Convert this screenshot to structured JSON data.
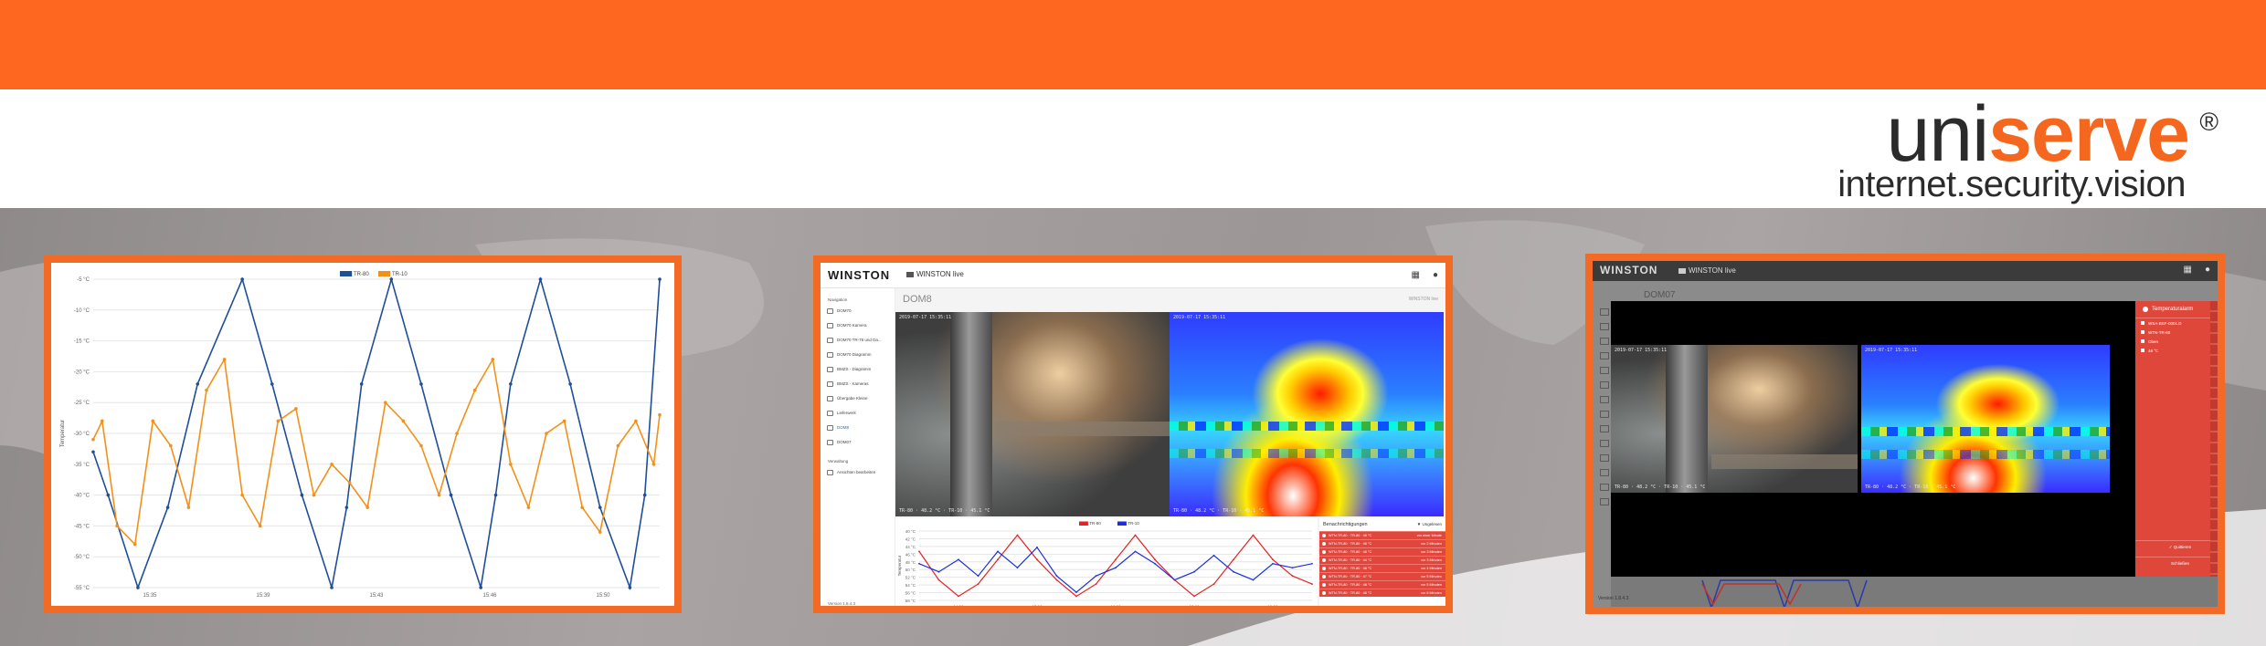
{
  "brand": {
    "logo_prefix": "uni",
    "logo_accent": "serve",
    "logo_registered": "®",
    "tagline": "internet.security.vision",
    "accent_color": "#fe671f"
  },
  "chart_data": [
    {
      "type": "line",
      "legend_position": "top-center",
      "grid": true,
      "ylabel": "Temperatur",
      "yticks": [
        "-5 °C",
        "-10 °C",
        "-15 °C",
        "-20 °C",
        "-25 °C",
        "-30 °C",
        "-35 °C",
        "-40 °C",
        "-45 °C",
        "-50 °C",
        "-55 °C"
      ],
      "ylim": [
        -55,
        -5
      ],
      "xticks": [
        "15:35",
        "15:39",
        "15:43",
        "15:46",
        "15:50"
      ],
      "series": [
        {
          "name": "TR-80",
          "color": "#1f4e9a",
          "x": [
            0,
            0.5,
            1.5,
            2.5,
            3.5,
            5,
            6,
            7,
            8,
            8.5,
            9,
            10,
            11,
            12,
            13,
            13.5,
            14,
            15,
            16,
            17,
            18,
            18.5,
            19
          ],
          "y": [
            -33,
            -40,
            -55,
            -42,
            -22,
            -5,
            -22,
            -40,
            -55,
            -42,
            -22,
            -5,
            -22,
            -40,
            -55,
            -40,
            -22,
            -5,
            -22,
            -42,
            -55,
            -40,
            -5
          ]
        },
        {
          "name": "TR-10",
          "color": "#f39019",
          "x": [
            0,
            0.3,
            0.8,
            1.4,
            2,
            2.6,
            3.2,
            3.8,
            4.4,
            5.0,
            5.6,
            6.2,
            6.8,
            7.4,
            8,
            8.6,
            9.2,
            9.8,
            10.4,
            11,
            11.6,
            12.2,
            12.8,
            13.4,
            14,
            14.6,
            15.2,
            15.8,
            16.4,
            17,
            17.6,
            18.2,
            18.8,
            19
          ],
          "y": [
            -31,
            -28,
            -45,
            -48,
            -28,
            -32,
            -42,
            -23,
            -18,
            -40,
            -45,
            -28,
            -26,
            -40,
            -35,
            -38,
            -42,
            -25,
            -28,
            -32,
            -40,
            -30,
            -23,
            -18,
            -35,
            -42,
            -30,
            -28,
            -42,
            -46,
            -32,
            -28,
            -35,
            -27
          ]
        }
      ]
    },
    {
      "type": "line",
      "legend_position": "top-center",
      "ylabel": "Temperatur",
      "yticks": [
        "40 °C",
        "42 °C",
        "44 °C",
        "46 °C",
        "48 °C",
        "50 °C",
        "52 °C",
        "54 °C",
        "56 °C",
        "58 °C"
      ],
      "xticks": [
        "14:00",
        "15:00",
        "16:00",
        "17:00",
        "18:00"
      ],
      "series": [
        {
          "name": "TR-80",
          "color": "#e62222",
          "x": [
            0,
            1,
            2,
            3,
            4,
            5,
            6,
            7,
            8,
            9,
            10,
            11,
            12,
            13,
            14,
            15,
            16,
            17,
            18,
            19,
            20
          ],
          "y": [
            52,
            45,
            41,
            44,
            50,
            56,
            50,
            45,
            41,
            44,
            50,
            56,
            50,
            45,
            41,
            44,
            50,
            56,
            50,
            46,
            44
          ]
        },
        {
          "name": "TR-10",
          "color": "#1a2fe0",
          "x": [
            0,
            1,
            2,
            3,
            4,
            5,
            6,
            7,
            8,
            9,
            10,
            11,
            12,
            13,
            14,
            15,
            16,
            17,
            18,
            19,
            20
          ],
          "y": [
            49,
            47,
            50,
            46,
            52,
            48,
            53,
            46,
            42,
            46,
            48,
            52,
            49,
            45,
            47,
            51,
            47,
            45,
            49,
            48,
            49
          ]
        }
      ]
    }
  ],
  "winston": {
    "logo": "WINSTON",
    "app_name": "WINSTON live",
    "page_title": "DOM8",
    "breadcrumb": "WINSTON live",
    "sidebar_section_1": "Navigation",
    "sidebar_items": [
      "DOM70",
      "DOM70 Kamera",
      "DOM70 TR-78 und Da...",
      "DOM70 Diagramm",
      "BMZS - Diagramm",
      "BMZS - Kameras",
      "Übergabe Kleine",
      "Lieferwerk",
      "DOM8",
      "DOM07"
    ],
    "sidebar_section_2": "Verwaltung",
    "sidebar_admin_item": "Ansichten bearbeiten",
    "version": "Version 1.8.4.3",
    "notifications_title": "Benachrichtigungen",
    "notifications_filter": "Ungelesen",
    "notifications": [
      {
        "text": "WTN-TR-80 · TR-80 · 48 °C",
        "age": "vor einer Minute"
      },
      {
        "text": "WTN-TR-80 · TR-80 · 46 °C",
        "age": "vor 2 Minuten"
      },
      {
        "text": "WTN-TR-80 · TR-80 · 45 °C",
        "age": "vor 3 Minuten"
      },
      {
        "text": "WTN-TR-80 · TR-80 · 44 °C",
        "age": "vor 3 Minuten"
      },
      {
        "text": "WTN-TR-80 · TR-80 · 46 °C",
        "age": "vor 4 Minuten"
      },
      {
        "text": "WTN-TR-80 · TR-80 · 47 °C",
        "age": "vor 5 Minuten"
      },
      {
        "text": "WTN-TR-80 · TR-80 · 48 °C",
        "age": "vor 5 Minuten"
      },
      {
        "text": "WTN-TR-80 · TR-80 · 46 °C",
        "age": "vor 6 Minuten"
      }
    ],
    "cam_overlay_top": "2019-07-17 15:35:11",
    "cam_overlay_bottom": "TR-80 · 48.2 °C · TR-10 · 45.1 °C"
  },
  "winston_detail": {
    "page_title": "DOM07",
    "panel_title": "Temperaturalarm",
    "panel_items": [
      "WSA-BSF-0001.D",
      "WTN-TR-80",
      "Oben",
      "48 °C"
    ],
    "button_confirm": "✓ Quittieren",
    "button_close": "Schließen",
    "version": "Version 1.8.4.3"
  }
}
